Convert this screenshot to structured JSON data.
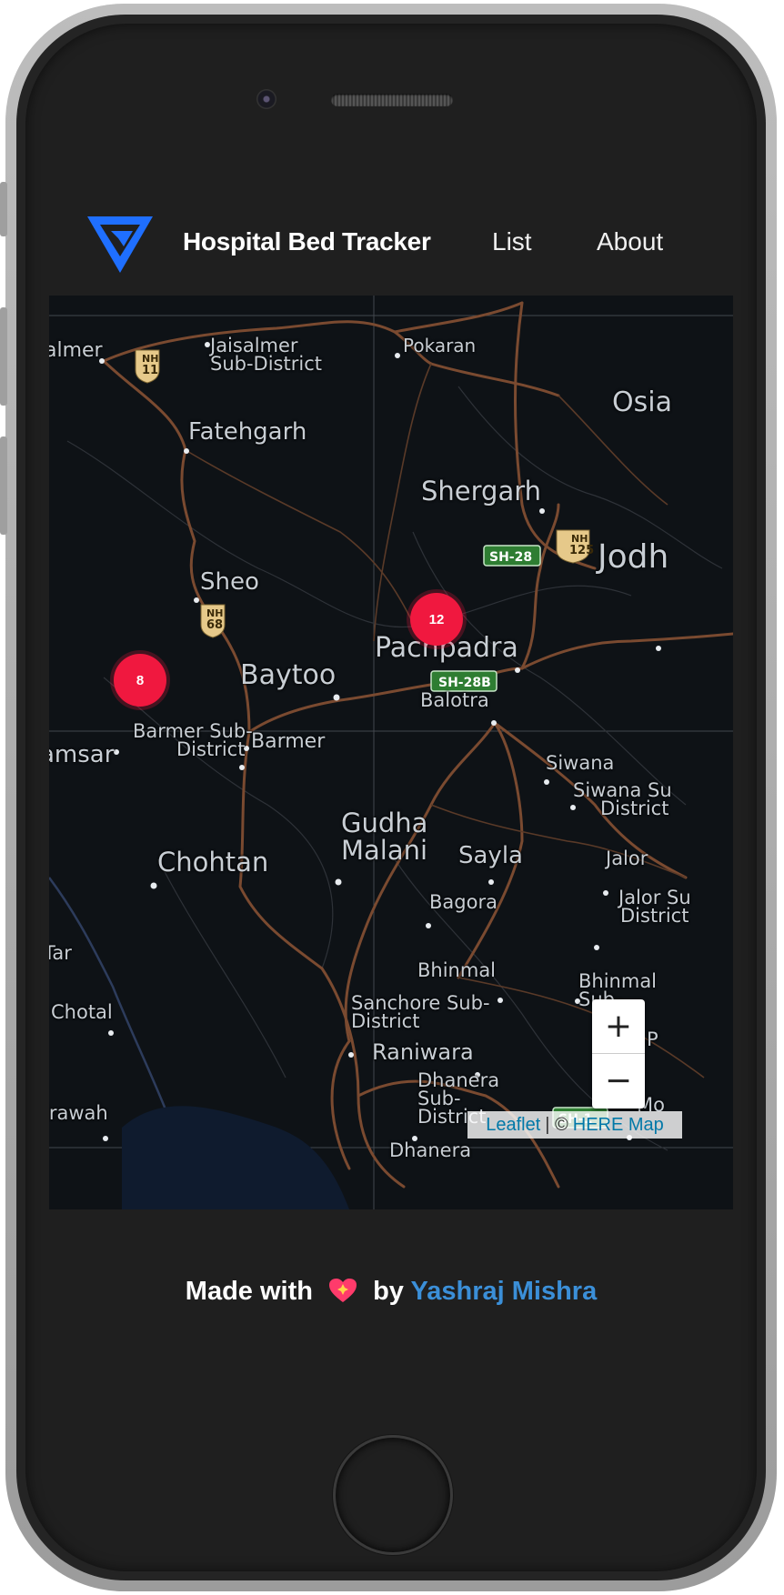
{
  "app": {
    "brand": "Hospital Bed Tracker",
    "nav": [
      {
        "label": "List"
      },
      {
        "label": "About"
      }
    ]
  },
  "map": {
    "clusters": [
      {
        "count": "12"
      },
      {
        "count": "8"
      }
    ],
    "zoom_in": "+",
    "zoom_out": "−",
    "attribution": {
      "leaflet": "Leaflet",
      "separator": "| ©",
      "provider": "HERE Map"
    },
    "places": [
      "almer",
      "Jaisalmer",
      "Sub-District",
      "Pokaran",
      "Fatehgarh",
      "Osia",
      "Shergarh",
      "Jodh",
      "Sheo",
      "Pachpadra",
      "Baytoo",
      "Balotra",
      "amsar",
      "Barmer Sub-",
      "District",
      "Barmer",
      "Siwana",
      "Siwana Su",
      "District",
      "Gudha",
      "Malani",
      "Sayla",
      "Chohtan",
      "Jalor",
      "Bagora",
      "Jalor Su",
      "District",
      "Tar",
      "Bhinmal",
      "Bhinmal",
      "Sub-",
      "Chotal",
      "Sanchore Sub-",
      "District",
      "Raniwara",
      "Dhanera",
      "Sub-",
      "District",
      "irawah",
      "Dhanera",
      "Mo",
      "P"
    ],
    "road_shields": [
      "NH",
      "11",
      "NH",
      "125",
      "SH-28",
      "NH",
      "68",
      "SH-28B",
      "SH-1"
    ],
    "colors": {
      "roads": "#7a4a30",
      "cluster": "#f0183f",
      "label": "#c8ced4"
    }
  },
  "footer": {
    "made_with": "Made with",
    "by": "by",
    "author": "Yashraj Mishra"
  }
}
